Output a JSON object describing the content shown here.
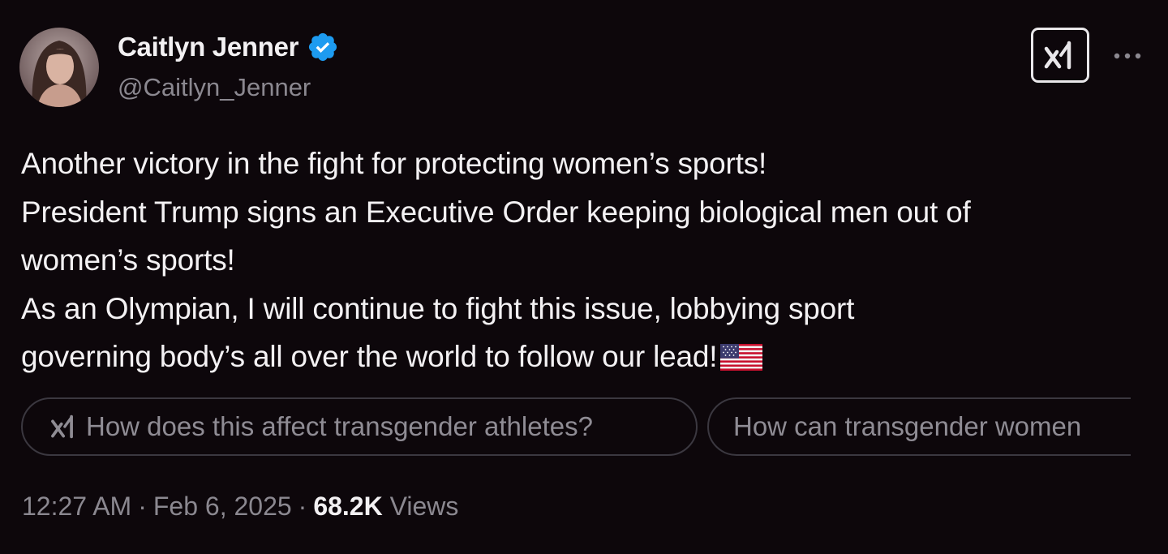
{
  "author": {
    "display_name": "Caitlyn Jenner",
    "handle": "@Caitlyn_Jenner",
    "verified": true,
    "verified_color": "#1d9bf0"
  },
  "header": {
    "grok_icon": "grok-logo-icon",
    "more_icon": "more-horizontal-icon"
  },
  "tweet": {
    "lines": [
      "Another victory in the fight for protecting women’s sports!",
      "President Trump signs an Executive Order keeping biological men out of",
      "women’s sports!",
      "As an Olympian, I will continue to fight this issue, lobbying sport",
      "governing body’s all over the world to follow our lead!"
    ],
    "trailing_emoji": "us-flag-emoji"
  },
  "grok_suggestions": [
    "How does this affect transgender athletes?",
    "How can transgender women"
  ],
  "meta": {
    "time": "12:27 AM",
    "separator": "·",
    "date": "Feb 6, 2025",
    "views_count": "68.2K",
    "views_label": "Views"
  },
  "colors": {
    "background": "#0d070b",
    "text": "#f3f1f3",
    "secondary": "#8b8890",
    "chip_border": "#3b3840"
  }
}
